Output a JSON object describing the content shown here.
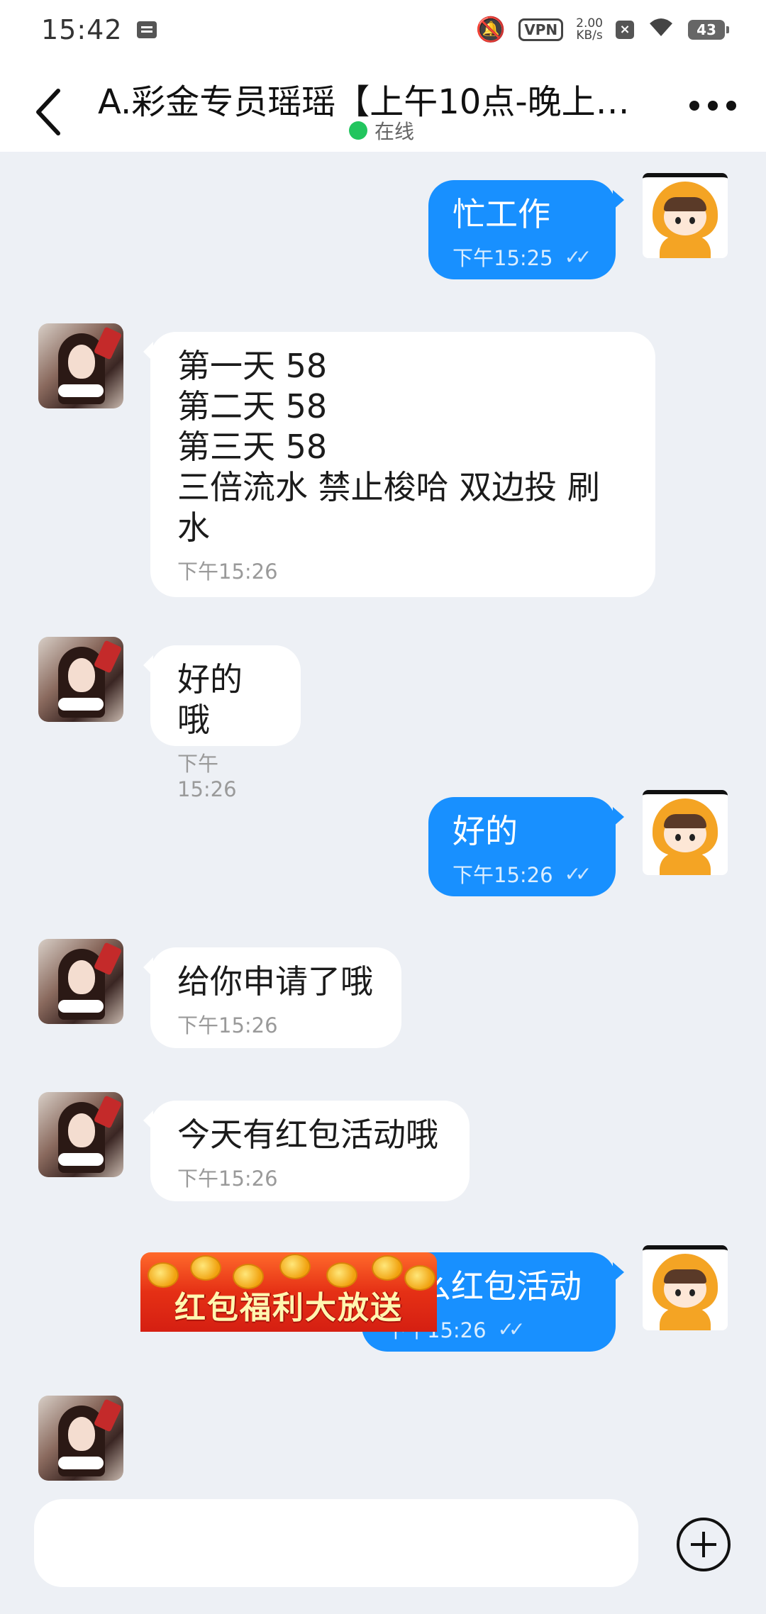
{
  "status_bar": {
    "time": "15:42",
    "vpn_label": "VPN",
    "speed_value": "2.00",
    "speed_unit": "KB/s",
    "battery": "43"
  },
  "header": {
    "title": "A.彩金专员瑶瑶【上午10点-晚上…",
    "status": "在线"
  },
  "messages": [
    {
      "side": "out",
      "text": "忙工作",
      "time": "下午15:25"
    },
    {
      "side": "in",
      "text": "第一天 58\n第二天 58\n第三天 58\n三倍流水 禁止梭哈 双边投 刷\n水",
      "time": "下午15:26"
    },
    {
      "side": "in",
      "text": "好的哦",
      "time": "下午15:26"
    },
    {
      "side": "out",
      "text": "好的",
      "time": "下午15:26"
    },
    {
      "side": "in",
      "text": "给你申请了哦",
      "time": "下午15:26"
    },
    {
      "side": "in",
      "text": "今天有红包活动哦",
      "time": "下午15:26"
    },
    {
      "side": "out",
      "text": "什么红包活动",
      "time": "下午15:26"
    }
  ],
  "image_message": {
    "banner_text": "红包福利大放送"
  },
  "composer": {
    "placeholder": ""
  },
  "icons": {
    "back": "chevron-left-icon",
    "more": "more-dots-icon",
    "read_receipt": "double-check-icon",
    "attach": "plus-circle-icon"
  },
  "colors": {
    "outgoing_bubble": "#1890ff",
    "incoming_bubble": "#ffffff",
    "background": "#edf0f5",
    "online_dot": "#22c55e"
  }
}
